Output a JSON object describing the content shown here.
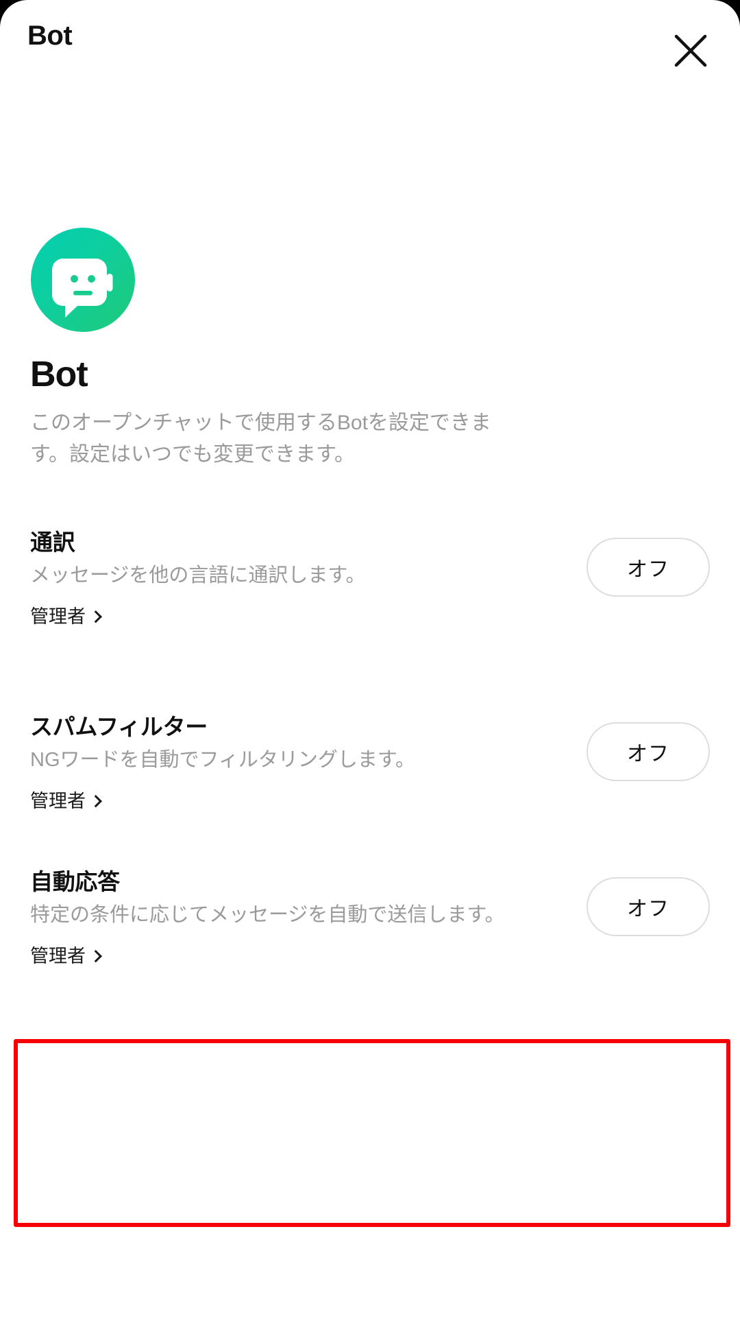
{
  "header": {
    "title": "Bot",
    "close_icon": "close-icon"
  },
  "hero": {
    "avatar_icon": "bot-avatar-icon",
    "title": "Bot",
    "description": "このオープンチャットで使用するBotを設定できます。設定はいつでも変更できます。"
  },
  "features": [
    {
      "title": "通訳",
      "description": "メッセージを他の言語に通訳します。",
      "admin_label": "管理者",
      "chevron_icon": "chevron-right-icon",
      "toggle_label": "オフ",
      "highlighted": false
    },
    {
      "title": "スパムフィルター",
      "description": "NGワードを自動でフィルタリングします。",
      "admin_label": "管理者",
      "chevron_icon": "chevron-right-icon",
      "toggle_label": "オフ",
      "highlighted": false
    },
    {
      "title": "自動応答",
      "description": "特定の条件に応じてメッセージを自動で送信します。",
      "admin_label": "管理者",
      "chevron_icon": "chevron-right-icon",
      "toggle_label": "オフ",
      "highlighted": true
    }
  ],
  "colors": {
    "background": "#000000",
    "sheet": "#ffffff",
    "text_primary": "#111111",
    "text_secondary": "#9a9a9a",
    "avatar_gradient_start": "#04cfb0",
    "avatar_gradient_end": "#1ecb7e",
    "pill_border": "#dddddd",
    "highlight": "#f60005"
  }
}
